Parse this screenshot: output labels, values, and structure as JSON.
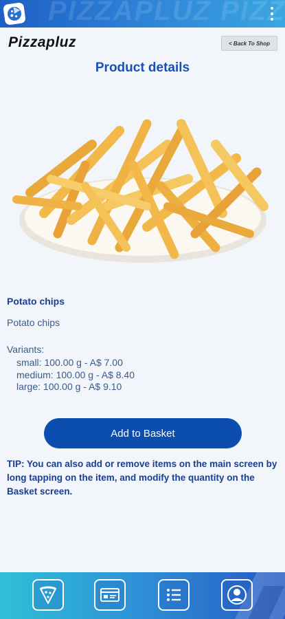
{
  "app": {
    "brand": "Pizzapluz",
    "watermark_text": "PIZZAPLUZ PIZZA"
  },
  "header": {
    "back_label": "< Back To Shop",
    "title": "Product details"
  },
  "product": {
    "name": "Potato chips",
    "description": "Potato chips",
    "variants_label": "Variants:",
    "variants": [
      "small: 100.00 g - A$ 7.00",
      "medium: 100.00 g - A$ 8.40",
      "large: 100.00 g - A$ 9.10"
    ]
  },
  "actions": {
    "add_to_basket": "Add to Basket"
  },
  "tip": "TIP: You can also add or remove items on the main screen by long tapping on the item, and modify the quantity on the Basket screen.",
  "bottom_nav": [
    {
      "icon": "pizza-slice-icon"
    },
    {
      "icon": "id-card-icon"
    },
    {
      "icon": "list-icon"
    },
    {
      "icon": "user-profile-icon"
    }
  ],
  "colors": {
    "accent": "#0b4eb0",
    "title": "#1a4fb5",
    "background": "#f2f5f9"
  }
}
